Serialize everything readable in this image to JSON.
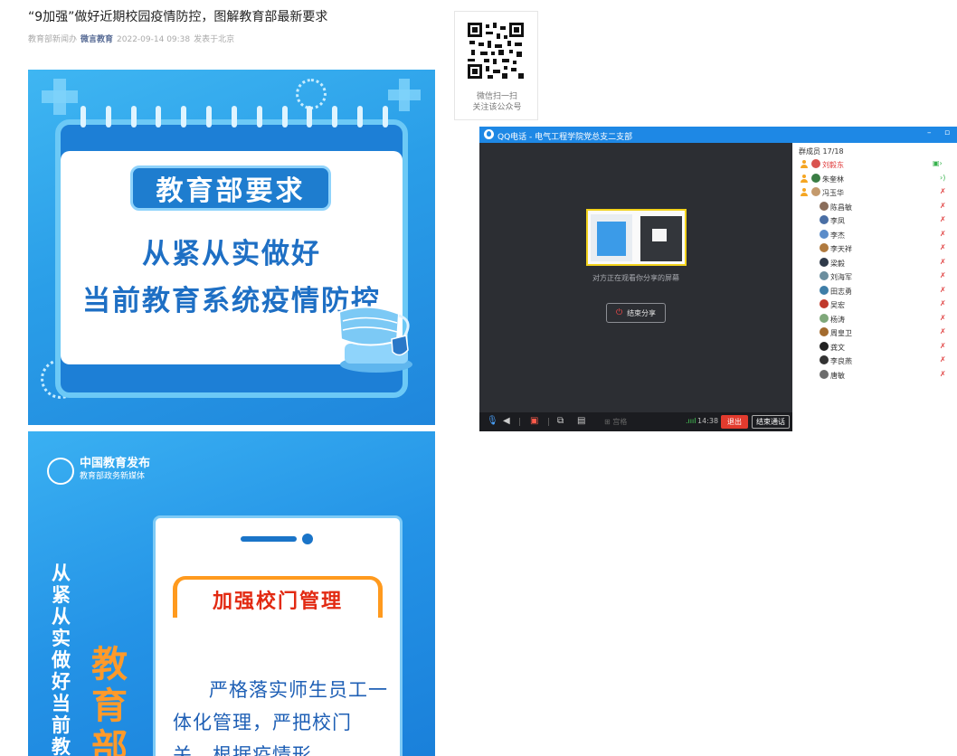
{
  "article": {
    "title": "“9加强”做好近期校园疫情防控，图解教育部最新要求",
    "source": "教育部新闻办",
    "account": "微言教育",
    "datetime": "2022-09-14 09:38",
    "location": "发表于北京"
  },
  "poster1": {
    "badge": "教育部要求",
    "line1": "从紧从实做好",
    "line2": "当前教育系统疫情防控"
  },
  "poster2": {
    "org": "中国教育发布",
    "org_sub": "教育部政务新媒体",
    "vertical_text": "从紧从实做好当前教",
    "big_text": "教育部",
    "section_title": "加强校门管理",
    "body_text": "严格落实师生员工一体化管理，严把校门关，根据疫情形"
  },
  "qr": {
    "caption1": "微信扫一扫",
    "caption2": "关注该公众号"
  },
  "qq_call": {
    "title": "QQ电话 - 电气工程学院党总支二支部",
    "window_minimize": "–",
    "window_restore": "▫",
    "sharing_notice": "对方正在观看你分享的屏幕",
    "end_share_label": "结束分享",
    "toolbar": {
      "grid_label": "宫格",
      "signal": ".ıııl",
      "time": "14:38",
      "exit_label": "退出",
      "end_call_label": "结束通话"
    },
    "members_header": "群成员 17/18",
    "members": [
      {
        "name": "刘毅东",
        "host": true,
        "status": "speaking-screen",
        "highlight": true,
        "avatar": "#d9534f"
      },
      {
        "name": "朱奎林",
        "host": true,
        "status": "speaking",
        "highlight": false,
        "avatar": "#3a7d44"
      },
      {
        "name": "冯玉华",
        "host": true,
        "status": "muted",
        "highlight": false,
        "avatar": "#c49a6c"
      },
      {
        "name": "陈昌敏",
        "host": false,
        "status": "muted",
        "highlight": false,
        "avatar": "#8a6d5a"
      },
      {
        "name": "李凤",
        "host": false,
        "status": "muted",
        "highlight": false,
        "avatar": "#4a6fa5"
      },
      {
        "name": "李杰",
        "host": false,
        "status": "muted",
        "highlight": false,
        "avatar": "#5b8cc9"
      },
      {
        "name": "李天祥",
        "host": false,
        "status": "muted",
        "highlight": false,
        "avatar": "#b07a3f"
      },
      {
        "name": "梁毅",
        "host": false,
        "status": "muted",
        "highlight": false,
        "avatar": "#2f3a4a"
      },
      {
        "name": "刘海军",
        "host": false,
        "status": "muted",
        "highlight": false,
        "avatar": "#6b8e9e"
      },
      {
        "name": "田志勇",
        "host": false,
        "status": "muted",
        "highlight": false,
        "avatar": "#3e7ea8"
      },
      {
        "name": "吴宏",
        "host": false,
        "status": "muted",
        "highlight": false,
        "avatar": "#c0392b"
      },
      {
        "name": "杨涛",
        "host": false,
        "status": "muted",
        "highlight": false,
        "avatar": "#7fa87a"
      },
      {
        "name": "周皇卫",
        "host": false,
        "status": "muted",
        "highlight": false,
        "avatar": "#a36b2e"
      },
      {
        "name": "龚文",
        "host": false,
        "status": "muted",
        "highlight": false,
        "avatar": "#222222"
      },
      {
        "name": "李良燕",
        "host": false,
        "status": "muted",
        "highlight": false,
        "avatar": "#333333"
      },
      {
        "name": "唐敏",
        "host": false,
        "status": "muted",
        "highlight": false,
        "avatar": "#6c6c6c"
      }
    ]
  },
  "colors": {
    "qq_blue": "#1e88e5",
    "exit_red": "#e23b2e",
    "host_highlight": "#e03b3b",
    "poster_blue": "#2a9ee8",
    "accent_orange": "#ff9a1e"
  }
}
